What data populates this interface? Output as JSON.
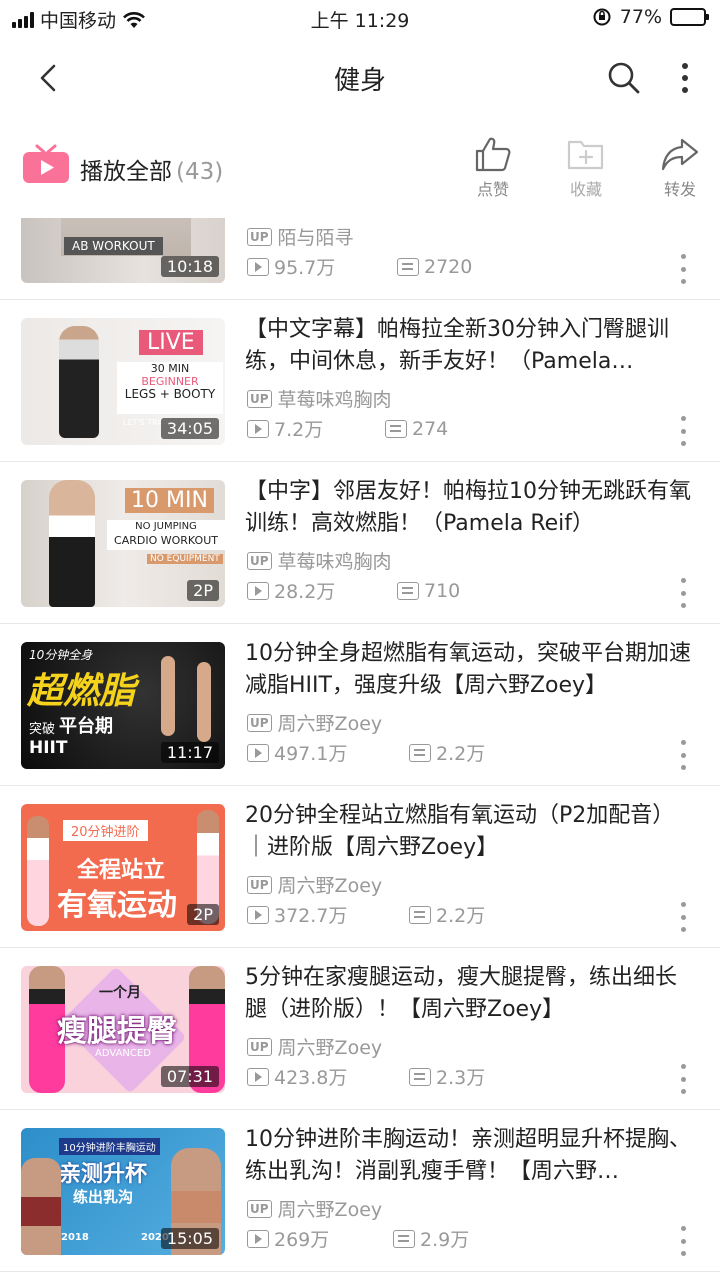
{
  "status_bar": {
    "carrier": "中国移动",
    "time": "上午 11:29",
    "battery": "77%",
    "battery_level": 0.77
  },
  "header": {
    "title": "健身"
  },
  "playbar": {
    "label": "播放全部",
    "count": "(43)",
    "like": "点赞",
    "fav": "收藏",
    "share": "转发"
  },
  "thumb_texts": {
    "v0": "AB WORKOUT",
    "v1": [
      "LIVE",
      "30 MIN",
      "BEGINNER",
      "LEGS + BOOTY",
      "LET'S TRAIN TOGETHER"
    ],
    "v2": [
      "10 MIN",
      "NO JUMPING",
      "CARDIO WORKOUT",
      "NO EQUIPMENT"
    ],
    "v3": [
      "10分钟全身",
      "超燃脂",
      "突破",
      "平台期",
      "HIIT"
    ],
    "v4": [
      "20分钟进阶",
      "全程站立",
      "有氧运动"
    ],
    "v5": [
      "一个月",
      "瘦腿提臀",
      "ADVANCED"
    ],
    "v6": [
      "10分钟进阶丰胸运动",
      "亲测升杯",
      "练出乳沟",
      "2018",
      "2020"
    ]
  },
  "videos": [
    {
      "title": "",
      "uploader": "陌与陌寻",
      "plays": "95.7万",
      "danmaku": "2720",
      "duration": "10:18"
    },
    {
      "title": "【中文字幕】帕梅拉全新30分钟入门臀腿训练，中间休息，新手友好！（Pamela…",
      "uploader": "草莓味鸡胸肉",
      "plays": "7.2万",
      "danmaku": "274",
      "duration": "34:05"
    },
    {
      "title": "【中字】邻居友好！帕梅拉10分钟无跳跃有氧训练！高效燃脂！（Pamela  Reif）",
      "uploader": "草莓味鸡胸肉",
      "plays": "28.2万",
      "danmaku": "710",
      "duration": "2P"
    },
    {
      "title": "10分钟全身超燃脂有氧运动，突破平台期加速减脂HIIT，强度升级【周六野Zoey】",
      "uploader": "周六野Zoey",
      "plays": "497.1万",
      "danmaku": "2.2万",
      "duration": "11:17"
    },
    {
      "title": "20分钟全程站立燃脂有氧运动（P2加配音）｜进阶版【周六野Zoey】",
      "uploader": "周六野Zoey",
      "plays": "372.7万",
      "danmaku": "2.2万",
      "duration": "2P"
    },
    {
      "title": "5分钟在家瘦腿运动，瘦大腿提臀，练出细长腿（进阶版）！【周六野Zoey】",
      "uploader": "周六野Zoey",
      "plays": "423.8万",
      "danmaku": "2.3万",
      "duration": "07:31"
    },
    {
      "title": "10分钟进阶丰胸运动！亲测超明显升杯提胸、练出乳沟！消副乳瘦手臂！【周六野…",
      "uploader": "周六野Zoey",
      "plays": "269万",
      "danmaku": "2.9万",
      "duration": "15:05"
    }
  ],
  "up_badge": "UP"
}
